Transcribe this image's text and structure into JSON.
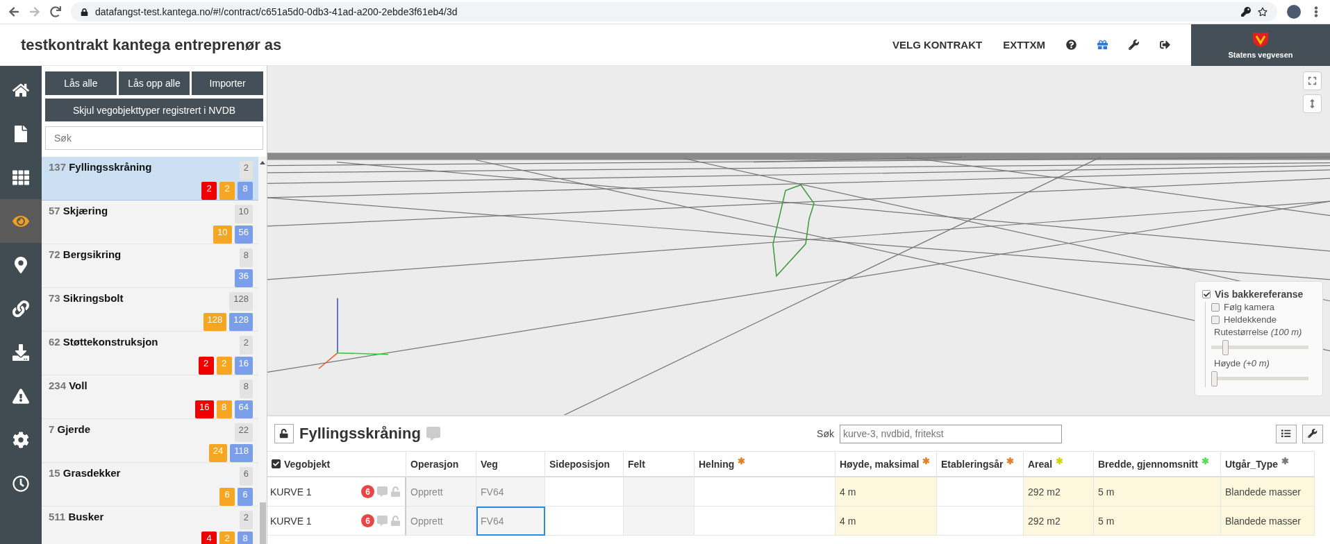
{
  "browser": {
    "url": "datafangst-test.kantega.no/#!/contract/c651a5d0-0db3-41ad-a200-2ebde3f61eb4/3d"
  },
  "header": {
    "title": "testkontrakt kantega entreprenør as",
    "nav": [
      "VELG KONTRAKT",
      "EXTTXM"
    ],
    "logo_text": "Statens vegvesen"
  },
  "rail": [
    {
      "kind": "home",
      "selected": false
    },
    {
      "kind": "file",
      "selected": false
    },
    {
      "kind": "grid",
      "selected": false
    },
    {
      "kind": "eye",
      "selected": true
    },
    {
      "kind": "marker",
      "selected": false
    },
    {
      "kind": "link",
      "selected": false
    },
    {
      "kind": "download",
      "selected": false
    },
    {
      "kind": "warning",
      "selected": false
    },
    {
      "kind": "settings",
      "selected": false
    },
    {
      "kind": "clock",
      "selected": false
    }
  ],
  "sidebar": {
    "buttons": [
      "Lås alle",
      "Lås opp alle",
      "Importer"
    ],
    "wide_button": "Skjul vegobjekttyper registrert i NVDB",
    "search": {
      "placeholder": "Søk"
    },
    "items": [
      {
        "number": "137",
        "name": "Fyllingsskråning",
        "total": "2",
        "selected": true,
        "badges": [
          {
            "text": "2",
            "color": "#ee0000"
          },
          {
            "text": "2",
            "color": "#f5a623"
          },
          {
            "text": "8",
            "color": "#7b9ee8"
          }
        ]
      },
      {
        "number": "57",
        "name": "Skjæring",
        "total": "10",
        "selected": false,
        "badges": [
          {
            "text": "10",
            "color": "#f5a623"
          },
          {
            "text": "56",
            "color": "#7b9ee8"
          }
        ]
      },
      {
        "number": "72",
        "name": "Bergsikring",
        "total": "8",
        "selected": false,
        "badges": [
          {
            "text": "36",
            "color": "#7b9ee8"
          }
        ]
      },
      {
        "number": "73",
        "name": "Sikringsbolt",
        "total": "128",
        "selected": false,
        "badges": [
          {
            "text": "128",
            "color": "#f5a623"
          },
          {
            "text": "128",
            "color": "#7b9ee8"
          }
        ]
      },
      {
        "number": "62",
        "name": "Støttekonstruksjon",
        "total": "2",
        "selected": false,
        "badges": [
          {
            "text": "2",
            "color": "#ee0000"
          },
          {
            "text": "2",
            "color": "#f5a623"
          },
          {
            "text": "16",
            "color": "#7b9ee8"
          }
        ]
      },
      {
        "number": "234",
        "name": "Voll",
        "total": "8",
        "selected": false,
        "badges": [
          {
            "text": "16",
            "color": "#ee0000"
          },
          {
            "text": "8",
            "color": "#f5a623"
          },
          {
            "text": "64",
            "color": "#7b9ee8"
          }
        ]
      },
      {
        "number": "7",
        "name": "Gjerde",
        "total": "22",
        "selected": false,
        "badges": [
          {
            "text": "24",
            "color": "#f5a623"
          },
          {
            "text": "118",
            "color": "#7b9ee8"
          }
        ]
      },
      {
        "number": "15",
        "name": "Grasdekker",
        "total": "6",
        "selected": false,
        "badges": [
          {
            "text": "6",
            "color": "#f5a623"
          },
          {
            "text": "6",
            "color": "#7b9ee8"
          }
        ]
      },
      {
        "number": "511",
        "name": "Busker",
        "total": "2",
        "selected": false,
        "badges": [
          {
            "text": "4",
            "color": "#ee0000"
          },
          {
            "text": "2",
            "color": "#f5a623"
          },
          {
            "text": "8",
            "color": "#7b9ee8"
          }
        ]
      }
    ]
  },
  "ground_panel": {
    "main": {
      "label": "Vis bakkereferanse",
      "checked": true
    },
    "options": [
      {
        "label": "Følg kamera",
        "checked": false
      },
      {
        "label": "Heldekkende",
        "checked": false
      }
    ],
    "sliders": [
      {
        "label": "Rutestørrelse",
        "value": "(100 m)",
        "level": 0.12
      },
      {
        "label": "Høyde",
        "value": "(+0 m)",
        "level": 0.0
      }
    ]
  },
  "table_panel": {
    "title": "Fyllingsskråning",
    "search_label": "Søk",
    "search": {
      "placeholder": "kurve-3, nvdbid, fritekst"
    },
    "columns": [
      {
        "label": "Vegobjekt",
        "kind": "check",
        "checked": true
      },
      {
        "label": "Operasjon",
        "kind": "readonly"
      },
      {
        "label": "Veg",
        "kind": "readonly"
      },
      {
        "label": "Sideposisjon",
        "kind": "plain"
      },
      {
        "label": "Felt",
        "kind": "readonly"
      },
      {
        "label": "Helning",
        "kind": "plain",
        "marker": {
          "text": "✱",
          "color": "#e67e22"
        }
      },
      {
        "label": "Høyde, maksimal",
        "kind": "highlight",
        "marker": {
          "text": "✱",
          "color": "#e67e22"
        }
      },
      {
        "label": "Etableringsår",
        "kind": "plain",
        "marker": {
          "text": "✱",
          "color": "#e67e22"
        }
      },
      {
        "label": "Areal",
        "kind": "highlight",
        "marker": {
          "text": "✱",
          "color": "#d4d400"
        }
      },
      {
        "label": "Bredde, gjennomsnitt",
        "kind": "highlight",
        "marker": {
          "text": "✱",
          "color": "#55dd55"
        }
      },
      {
        "label": "Utgår_Type",
        "kind": "highlight",
        "marker": {
          "text": "✱",
          "color": "#777777"
        }
      }
    ],
    "rows": [
      {
        "cells": [
          {
            "text": "KURVE 1",
            "count": "6",
            "selected": false
          },
          {
            "text": "Opprett",
            "selected": false
          },
          {
            "text": "FV64",
            "selected": false
          },
          {
            "selected": false
          },
          {
            "selected": false
          },
          {
            "selected": false
          },
          {
            "text": "4 m",
            "selected": false
          },
          {
            "selected": false
          },
          {
            "text": "292 m2",
            "selected": false
          },
          {
            "text": "5 m",
            "selected": false
          },
          {
            "text": "Blandede masser",
            "selected": false
          }
        ]
      },
      {
        "cells": [
          {
            "text": "KURVE 1",
            "count": "6",
            "selected": false
          },
          {
            "text": "Opprett",
            "selected": false
          },
          {
            "text": "FV64",
            "selected": true
          },
          {
            "selected": false
          },
          {
            "selected": false
          },
          {
            "selected": false
          },
          {
            "text": "4 m",
            "selected": false
          },
          {
            "selected": false
          },
          {
            "text": "292 m2",
            "selected": false
          },
          {
            "text": "5 m",
            "selected": false
          },
          {
            "text": "Blandede masser",
            "selected": false
          }
        ]
      }
    ]
  }
}
